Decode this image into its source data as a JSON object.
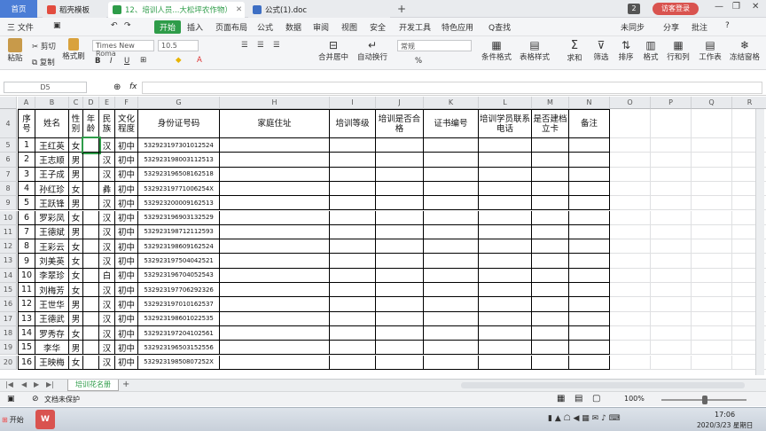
{
  "titlebar": {
    "tabs": [
      {
        "label": "首页",
        "active": true
      },
      {
        "label": "稻壳模板"
      },
      {
        "label": "12、培训人员...大松坪农作物）"
      },
      {
        "label": "公式(1).doc"
      }
    ],
    "page_count": "2",
    "login_label": "访客登录"
  },
  "menubar": {
    "file_label": "三 文件",
    "items": [
      "开始",
      "插入",
      "页面布局",
      "公式",
      "数据",
      "审阅",
      "视图",
      "安全",
      "开发工具",
      "特色应用"
    ],
    "search_label": "Q查找",
    "unsynced": "未同步",
    "share": "分享",
    "comment": "批注"
  },
  "ribbon": {
    "cut": "剪切",
    "copy": "复制",
    "paste": "粘贴",
    "format_painter": "格式刷",
    "font_name": "Times New Roma",
    "font_size": "10.5",
    "merge": "合并居中",
    "wrap": "自动换行",
    "number_format": "常规",
    "cond_format": "条件格式",
    "table_style": "表格样式",
    "sum": "求和",
    "filter": "筛选",
    "sort": "排序",
    "format": "格式",
    "rows_cols": "行和列",
    "worksheet": "工作表",
    "freeze": "冻结窗格"
  },
  "formula_bar": {
    "cell_ref": "D5",
    "fx": "fx"
  },
  "sheet": {
    "columns": [
      "A",
      "B",
      "C",
      "D",
      "E",
      "F",
      "G",
      "H",
      "I",
      "J",
      "K",
      "L",
      "M",
      "N",
      "O",
      "P",
      "Q",
      "R"
    ],
    "row_numbers": [
      "4",
      "5",
      "6",
      "7",
      "8",
      "9",
      "10",
      "11",
      "12",
      "13",
      "14",
      "15",
      "16",
      "17",
      "18",
      "19",
      "20"
    ],
    "headers": [
      "序号",
      "姓名",
      "性别",
      "年龄",
      "民族",
      "文化程度",
      "身份证号码",
      "家庭住址",
      "培训等级",
      "培训是否合格",
      "证书编号",
      "培训学员联系电话",
      "是否建档立卡",
      "备注"
    ],
    "rows": [
      [
        "1",
        "王红英",
        "女",
        "",
        "汉",
        "初中",
        "532923197301012524"
      ],
      [
        "2",
        "王志顺",
        "男",
        "",
        "汉",
        "初中",
        "532923198003112513"
      ],
      [
        "3",
        "王子成",
        "男",
        "",
        "汉",
        "初中",
        "532923196508162518"
      ],
      [
        "4",
        "孙红珍",
        "女",
        "",
        "彝",
        "初中",
        "53292319771006254X"
      ],
      [
        "5",
        "王跃锋",
        "男",
        "",
        "汉",
        "初中",
        "532923200009162513"
      ],
      [
        "6",
        "罗彩凤",
        "女",
        "",
        "汉",
        "初中",
        "532923196903132529"
      ],
      [
        "7",
        "王德斌",
        "男",
        "",
        "汉",
        "初中",
        "532923198712112593"
      ],
      [
        "8",
        "王彩云",
        "女",
        "",
        "汉",
        "初中",
        "532923198609162524"
      ],
      [
        "9",
        "刘美英",
        "女",
        "",
        "汉",
        "初中",
        "532923197504042521"
      ],
      [
        "10",
        "李翠珍",
        "女",
        "",
        "白",
        "初中",
        "532923196704052543"
      ],
      [
        "11",
        "刘梅芳",
        "女",
        "",
        "汉",
        "初中",
        "532923197706292326"
      ],
      [
        "12",
        "王世华",
        "男",
        "",
        "汉",
        "初中",
        "532923197010162537"
      ],
      [
        "13",
        "王德武",
        "男",
        "",
        "汉",
        "初中",
        "532923198601022535"
      ],
      [
        "14",
        "罗秀存",
        "女",
        "",
        "汉",
        "初中",
        "532923197204102561"
      ],
      [
        "15",
        "李华",
        "男",
        "",
        "汉",
        "初中",
        "532923196503152556"
      ],
      [
        "16",
        "王映梅",
        "女",
        "",
        "汉",
        "初中",
        "53292319850807252X"
      ]
    ]
  },
  "sheet_tabs": {
    "active": "培训花名册",
    "add": "+"
  },
  "status": {
    "protect": "文档未保护",
    "zoom": "100%"
  },
  "taskbar": {
    "start": "开始",
    "time": "17:06",
    "date": "2020/3/23 星期日"
  },
  "colors": {
    "accent": "#2e9c49",
    "tab_active": "#4b7dd6",
    "login": "#d9534f"
  }
}
